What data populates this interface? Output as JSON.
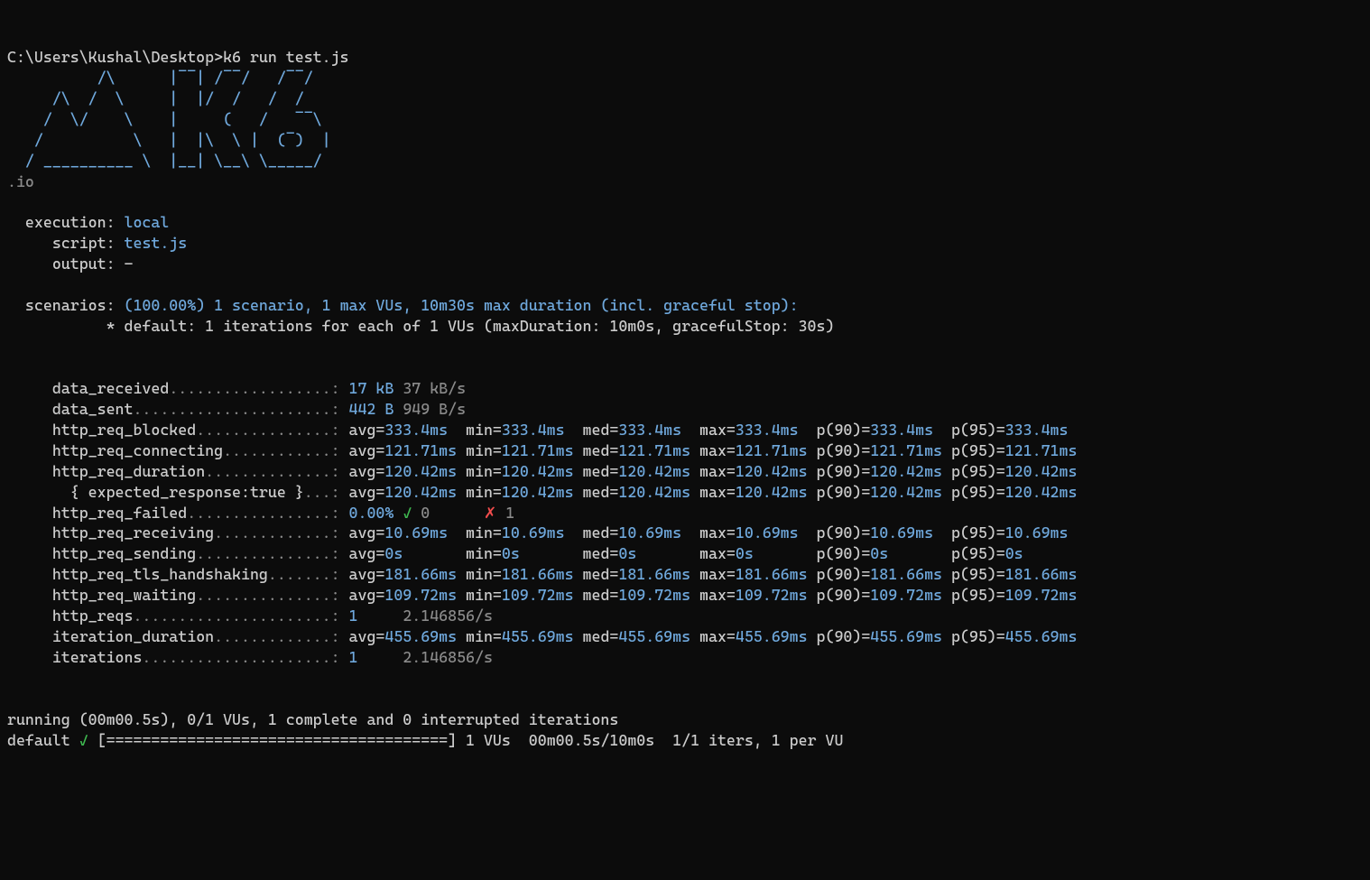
{
  "prompt": "C:\\Users\\Kushal\\Desktop>",
  "command": "k6 run test.js",
  "logo": {
    "l1": "          /\\      |‾‾| /‾‾/   /‾‾/",
    "l2": "     /\\  /  \\     |  |/  /   /  /",
    "l3": "    /  \\/    \\    |     (   /   ‾‾\\",
    "l4": "   /          \\   |  |\\  \\ |  (‾)  |",
    "l5": "  / __________ \\  |__| \\__\\ \\_____/ ",
    "l6": "",
    "io": ".io"
  },
  "header": {
    "execution": {
      "label": "execution:",
      "value": "local"
    },
    "script": {
      "label": "script:",
      "value": "test.js"
    },
    "output": {
      "label": "output:",
      "value": "-"
    },
    "scenarios": {
      "label": "scenarios:",
      "value": "(100.00%) 1 scenario, 1 max VUs, 10m30s max duration (incl. graceful stop):",
      "detail": "           * default: 1 iterations for each of 1 VUs (maxDuration: 10m0s, gracefulStop: 30s)"
    }
  },
  "metrics": [
    {
      "name": "data_received",
      "dots": "..................:",
      "v1": "17 kB",
      "v2": "37 kB/s"
    },
    {
      "name": "data_sent",
      "dots": "......................:",
      "v1": "442 B",
      "v2": "949 B/s"
    },
    {
      "name": "http_req_blocked",
      "dots": "...............:",
      "c": [
        {
          "k": "avg=",
          "v": "333.4ms"
        },
        {
          "k": "min=",
          "v": "333.4ms"
        },
        {
          "k": "med=",
          "v": "333.4ms"
        },
        {
          "k": "max=",
          "v": "333.4ms"
        },
        {
          "k": "p(90)=",
          "v": "333.4ms"
        },
        {
          "k": "p(95)=",
          "v": "333.4ms"
        }
      ]
    },
    {
      "name": "http_req_connecting",
      "dots": "............:",
      "c": [
        {
          "k": "avg=",
          "v": "121.71ms"
        },
        {
          "k": "min=",
          "v": "121.71ms"
        },
        {
          "k": "med=",
          "v": "121.71ms"
        },
        {
          "k": "max=",
          "v": "121.71ms"
        },
        {
          "k": "p(90)=",
          "v": "121.71ms"
        },
        {
          "k": "p(95)=",
          "v": "121.71ms"
        }
      ]
    },
    {
      "name": "http_req_duration",
      "dots": "..............:",
      "c": [
        {
          "k": "avg=",
          "v": "120.42ms"
        },
        {
          "k": "min=",
          "v": "120.42ms"
        },
        {
          "k": "med=",
          "v": "120.42ms"
        },
        {
          "k": "max=",
          "v": "120.42ms"
        },
        {
          "k": "p(90)=",
          "v": "120.42ms"
        },
        {
          "k": "p(95)=",
          "v": "120.42ms"
        }
      ]
    },
    {
      "name": "{ expected_response:true }",
      "dots": "...:",
      "c": [
        {
          "k": "avg=",
          "v": "120.42ms"
        },
        {
          "k": "min=",
          "v": "120.42ms"
        },
        {
          "k": "med=",
          "v": "120.42ms"
        },
        {
          "k": "max=",
          "v": "120.42ms"
        },
        {
          "k": "p(90)=",
          "v": "120.42ms"
        },
        {
          "k": "p(95)=",
          "v": "120.42ms"
        }
      ]
    },
    {
      "name": "http_req_failed",
      "dots": "................:",
      "pct": "0.00%",
      "check": "✓",
      "pass": "0",
      "x": "✗",
      "fail": "1"
    },
    {
      "name": "http_req_receiving",
      "dots": ".............:",
      "c": [
        {
          "k": "avg=",
          "v": "10.69ms"
        },
        {
          "k": "min=",
          "v": "10.69ms"
        },
        {
          "k": "med=",
          "v": "10.69ms"
        },
        {
          "k": "max=",
          "v": "10.69ms"
        },
        {
          "k": "p(90)=",
          "v": "10.69ms"
        },
        {
          "k": "p(95)=",
          "v": "10.69ms"
        }
      ]
    },
    {
      "name": "http_req_sending",
      "dots": "...............:",
      "c": [
        {
          "k": "avg=",
          "v": "0s"
        },
        {
          "k": "min=",
          "v": "0s"
        },
        {
          "k": "med=",
          "v": "0s"
        },
        {
          "k": "max=",
          "v": "0s"
        },
        {
          "k": "p(90)=",
          "v": "0s"
        },
        {
          "k": "p(95)=",
          "v": "0s"
        }
      ]
    },
    {
      "name": "http_req_tls_handshaking",
      "dots": ".......:",
      "c": [
        {
          "k": "avg=",
          "v": "181.66ms"
        },
        {
          "k": "min=",
          "v": "181.66ms"
        },
        {
          "k": "med=",
          "v": "181.66ms"
        },
        {
          "k": "max=",
          "v": "181.66ms"
        },
        {
          "k": "p(90)=",
          "v": "181.66ms"
        },
        {
          "k": "p(95)=",
          "v": "181.66ms"
        }
      ]
    },
    {
      "name": "http_req_waiting",
      "dots": "...............:",
      "c": [
        {
          "k": "avg=",
          "v": "109.72ms"
        },
        {
          "k": "min=",
          "v": "109.72ms"
        },
        {
          "k": "med=",
          "v": "109.72ms"
        },
        {
          "k": "max=",
          "v": "109.72ms"
        },
        {
          "k": "p(90)=",
          "v": "109.72ms"
        },
        {
          "k": "p(95)=",
          "v": "109.72ms"
        }
      ]
    },
    {
      "name": "http_reqs",
      "dots": "......................:",
      "v1": "1",
      "v2": "2.146856/s"
    },
    {
      "name": "iteration_duration",
      "dots": ".............:",
      "c": [
        {
          "k": "avg=",
          "v": "455.69ms"
        },
        {
          "k": "min=",
          "v": "455.69ms"
        },
        {
          "k": "med=",
          "v": "455.69ms"
        },
        {
          "k": "max=",
          "v": "455.69ms"
        },
        {
          "k": "p(90)=",
          "v": "455.69ms"
        },
        {
          "k": "p(95)=",
          "v": "455.69ms"
        }
      ]
    },
    {
      "name": "iterations",
      "dots": ".....................:",
      "v1": "1",
      "v2": "2.146856/s"
    }
  ],
  "footer": {
    "running": "running (00m00.5s), 0/1 VUs, 1 complete and 0 interrupted iterations",
    "scenario": "default",
    "check": "✓",
    "bar": "[======================================]",
    "tail": "1 VUs  00m00.5s/10m0s  1/1 iters, 1 per VU"
  }
}
